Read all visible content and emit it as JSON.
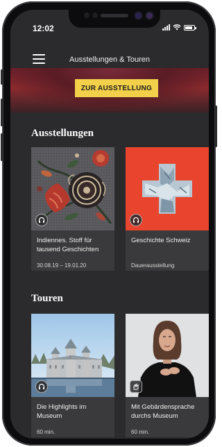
{
  "status": {
    "time": "12:02"
  },
  "nav": {
    "title": "Ausstellungen & Touren",
    "menu_icon": "hamburger-menu-icon"
  },
  "hero": {
    "button_label": "ZUR AUSSTELLUNG"
  },
  "exhibitions": {
    "heading": "Ausstellungen",
    "items": [
      {
        "title": "Indiennes. Stoff für tausend Geschichten",
        "meta": "30.08.19 – 19.01.20",
        "badge_icon": "headphones-icon"
      },
      {
        "title": "Geschichte Schweiz",
        "meta": "Dauerausstellung",
        "badge_icon": "headphones-icon"
      }
    ]
  },
  "tours": {
    "heading": "Touren",
    "items": [
      {
        "title": "Die Highlights im Museum",
        "meta": "60 min.",
        "badge_icon": "headphones-icon"
      },
      {
        "title": "Mit Gebärdensprache durchs Museum",
        "meta": "60 min.",
        "badge_icon": "sign-language-icon"
      }
    ]
  },
  "colors": {
    "accent_yellow": "#f2d04a",
    "swiss_red": "#e8442e",
    "background": "#2b2a2c"
  }
}
